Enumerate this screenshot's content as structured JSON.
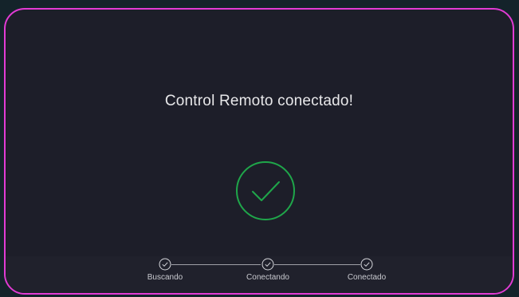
{
  "dialog": {
    "title": "Control Remoto conectado!",
    "status_icon": "check-circle-icon",
    "accent_color": "#1fa64a",
    "border_color": "#e23bd4"
  },
  "steps": [
    {
      "label": "Buscando",
      "icon": "check-circle-icon",
      "completed": true
    },
    {
      "label": "Conectando",
      "icon": "check-circle-icon",
      "completed": true
    },
    {
      "label": "Conectado",
      "icon": "check-circle-icon",
      "completed": true
    }
  ]
}
